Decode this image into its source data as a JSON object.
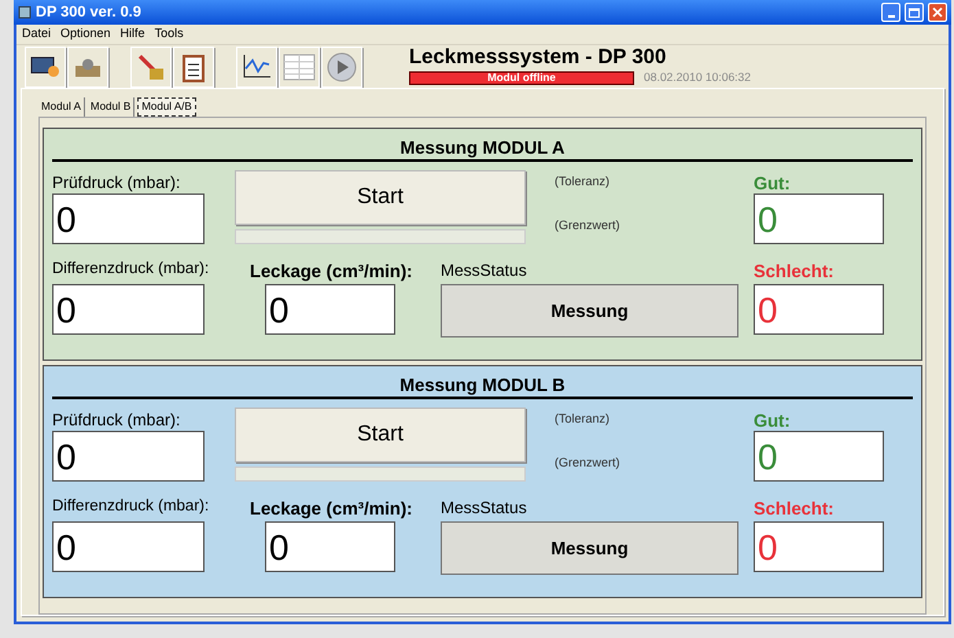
{
  "window": {
    "title": "DP 300 ver. 0.9"
  },
  "menu": [
    "Datei",
    "Optionen",
    "Hilfe",
    "Tools"
  ],
  "header": {
    "title": "Leckmesssystem - DP 300",
    "status": "Modul offline",
    "timestamp": "08.02.2010 10:06:32"
  },
  "tabs": [
    {
      "label": "Modul A",
      "selected": false
    },
    {
      "label": "Modul B",
      "selected": false
    },
    {
      "label": "Modul A/B",
      "selected": true
    }
  ],
  "modules": [
    {
      "title": "Messung MODUL A",
      "color": "#d2e3cb",
      "pruefdruck_label": "Prüfdruck (mbar):",
      "pruefdruck": "0",
      "start": "Start",
      "progress": {
        "level": 0
      },
      "toleranz": "(Toleranz)",
      "grenzwert": "(Grenzwert)",
      "gut_label": "Gut:",
      "gut": "0",
      "differenz_label": "Differenzdruck (mbar):",
      "differenz": "0",
      "leckage_label": "Leckage (cm³/min):",
      "leckage": "0",
      "status_label": "MessStatus",
      "status": "Messung",
      "schlecht_label": "Schlecht:",
      "schlecht": "0"
    },
    {
      "title": "Messung MODUL B",
      "color": "#b9d8ec",
      "pruefdruck_label": "Prüfdruck (mbar):",
      "pruefdruck": "0",
      "start": "Start",
      "progress": {
        "level": 0
      },
      "toleranz": "(Toleranz)",
      "grenzwert": "(Grenzwert)",
      "gut_label": "Gut:",
      "gut": "0",
      "differenz_label": "Differenzdruck (mbar):",
      "differenz": "0",
      "leckage_label": "Leckage (cm³/min):",
      "leckage": "0",
      "status_label": "MessStatus",
      "status": "Messung",
      "schlecht_label": "Schlecht:",
      "schlecht": "0"
    }
  ]
}
